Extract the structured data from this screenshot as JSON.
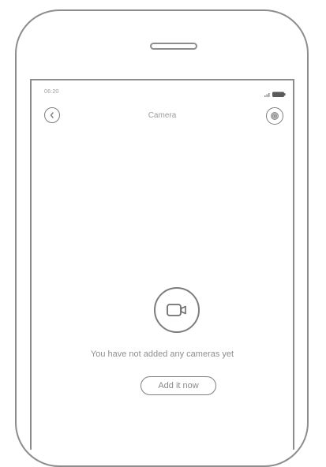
{
  "status_bar": {
    "time": "06:20",
    "icons": [
      "signal-icon",
      "battery-icon"
    ]
  },
  "header": {
    "title": "Camera",
    "back_icon": "chevron-left-icon",
    "settings_icon": "gear-icon"
  },
  "empty_state": {
    "icon": "video-camera-icon",
    "message": "You have not added any cameras yet",
    "action_label": "Add it now"
  },
  "colors": {
    "outline": "#8d8d8d",
    "text": "#9a9a9a",
    "background": "#ffffff"
  }
}
